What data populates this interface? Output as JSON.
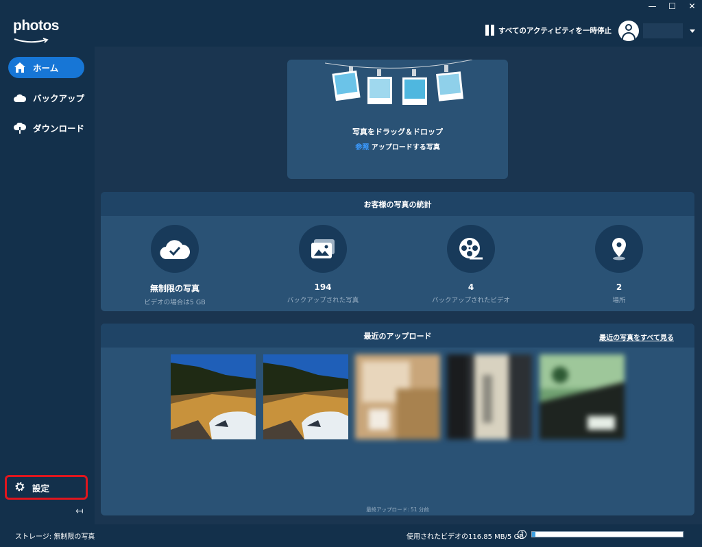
{
  "app": {
    "logo_text": "photos",
    "window_controls": [
      "—",
      "☐",
      "✕"
    ]
  },
  "header": {
    "pause_label": "すべてのアクティビティを一時停止"
  },
  "sidebar": {
    "items": [
      {
        "label": "ホーム",
        "icon": "home-icon",
        "active": true
      },
      {
        "label": "バックアップ",
        "icon": "cloud-icon",
        "active": false
      },
      {
        "label": "ダウンロード",
        "icon": "cloud-download-icon",
        "active": false
      }
    ],
    "settings_label": "設定",
    "collapse_glyph": "↤"
  },
  "dropzone": {
    "title": "写真をドラッグ＆ドロップ",
    "link": "参照",
    "subtitle": " アップロードする写真"
  },
  "stats": {
    "title": "お客様の写真の統計",
    "items": [
      {
        "value": "無制限の写真",
        "label": "ビデオの場合は5 GB",
        "icon": "cloud-check-icon"
      },
      {
        "value": "194",
        "label": "バックアップされた写真",
        "icon": "photo-icon"
      },
      {
        "value": "4",
        "label": "バックアップされたビデオ",
        "icon": "film-reel-icon"
      },
      {
        "value": "2",
        "label": "場所",
        "icon": "location-pin-icon"
      }
    ]
  },
  "recent": {
    "title": "最近のアップロード",
    "see_all": "最近の写真をすべて見る",
    "last_upload": "最終アップロード: 51 分前"
  },
  "statusbar": {
    "storage": "ストレージ: 無制限の写真",
    "video_usage": "使用されたビデオの116.85 MB/5 GB",
    "help": "?",
    "video_usage_fraction": 0.023
  },
  "colors": {
    "accent": "#1776d6",
    "link": "#3b9aff",
    "highlight_border": "#e0161e"
  }
}
